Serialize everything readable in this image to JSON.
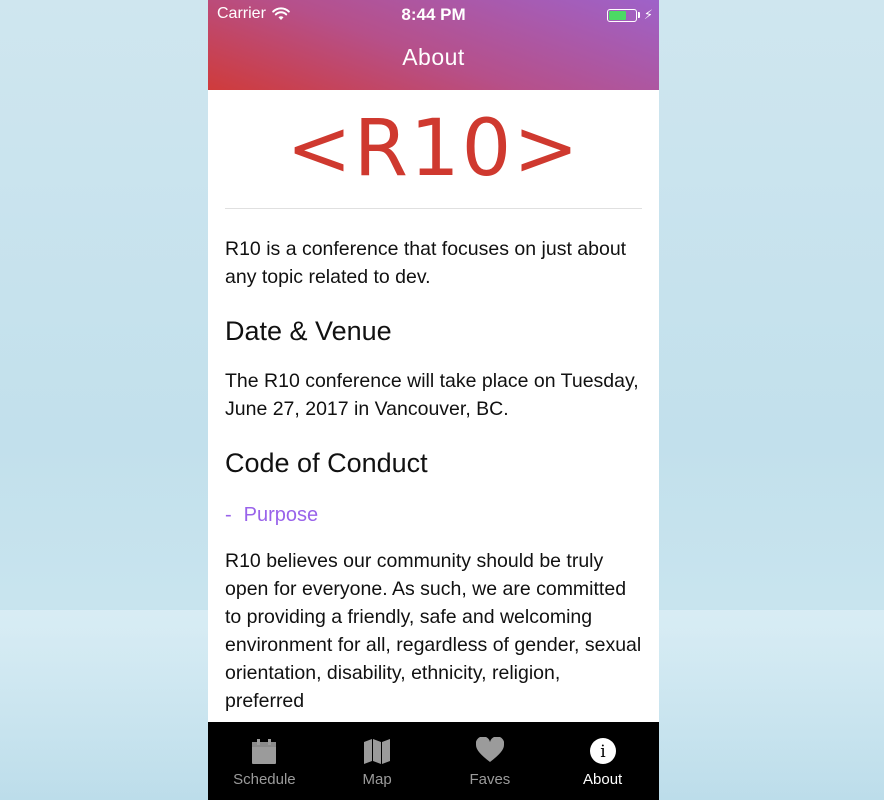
{
  "status_bar": {
    "carrier": "Carrier",
    "time": "8:44 PM",
    "battery_level": 0.6,
    "icons": [
      "wifi-icon",
      "battery-icon",
      "charging-bolt-icon"
    ]
  },
  "header": {
    "title": "About",
    "gradient": [
      "#9e62c9",
      "#cf3b3b"
    ]
  },
  "logo": {
    "text": "<R10>",
    "color": "#cf392f"
  },
  "content": {
    "intro": "R10 is a conference that focuses on just about any topic related to dev.",
    "date_venue_heading": "Date & Venue",
    "date_venue_text": "The R10 conference will take place on Tuesday, June 27, 2017 in Vancouver, BC.",
    "conduct_heading": "Code of Conduct",
    "purpose_dash": "-",
    "purpose_label": "Purpose",
    "purpose_color": "#9963ea",
    "purpose_text": "R10 believes our community should be truly open for everyone. As such, we are committed to providing a friendly, safe and welcoming environment for all, regardless of gender, sexual orientation, disability, ethnicity, religion, preferred"
  },
  "tabbar": {
    "tabs": [
      {
        "label": "Schedule",
        "icon": "calendar-icon",
        "active": false
      },
      {
        "label": "Map",
        "icon": "map-icon",
        "active": false
      },
      {
        "label": "Faves",
        "icon": "heart-icon",
        "active": false
      },
      {
        "label": "About",
        "icon": "info-icon",
        "active": true
      }
    ]
  }
}
